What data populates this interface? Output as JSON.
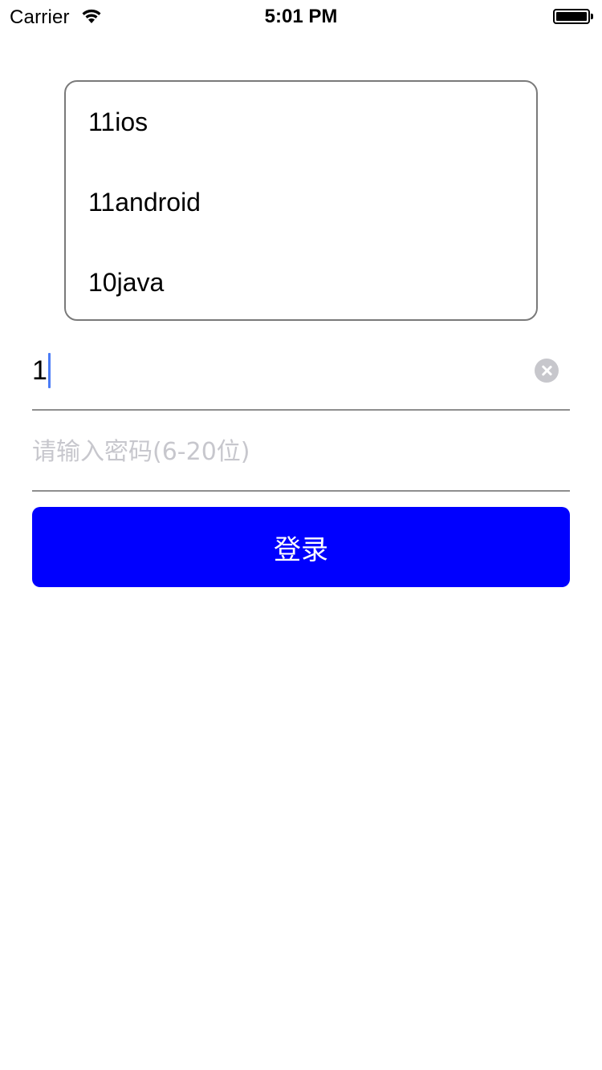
{
  "status_bar": {
    "carrier": "Carrier",
    "time": "5:01 PM",
    "icons": [
      "wifi-icon",
      "battery-icon"
    ]
  },
  "dropdown": {
    "items": [
      {
        "label": "11ios"
      },
      {
        "label": "11android"
      },
      {
        "label": "10java"
      }
    ]
  },
  "account_field": {
    "value": "1",
    "clear_icon": "clear-icon"
  },
  "password_field": {
    "value": "",
    "placeholder": "请输入密码(6-20位)"
  },
  "login_button": {
    "label": "登录",
    "color": "#0000ff"
  }
}
